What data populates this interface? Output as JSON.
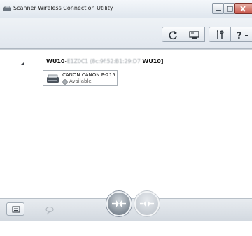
{
  "window": {
    "title": "Scanner Wireless Connection Utility"
  },
  "toolbar": {
    "help_label": "?"
  },
  "device_tree": {
    "scanner_name_prefix": "WU10-",
    "scanner_name_hidden": "E1Z0C1 (8c:9f:52:B1:29:D7",
    "scanner_name_suffix": " WU10]",
    "device": {
      "model": "CANON CANON P-215",
      "status": "Available",
      "status_color": "#9aa0a6"
    }
  },
  "icons": {
    "app": "scanner-icon",
    "refresh": "refresh-icon",
    "screen": "display-icon",
    "tools": "tools-icon",
    "help": "help-icon",
    "list": "list-icon",
    "comment": "speech-bubble-icon",
    "connect": "connect-icon",
    "disconnect": "disconnect-icon"
  }
}
